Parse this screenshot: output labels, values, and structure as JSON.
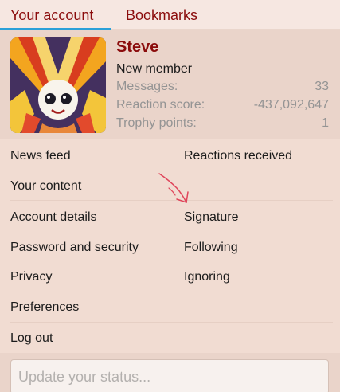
{
  "tabs": {
    "account": "Your account",
    "bookmarks": "Bookmarks",
    "active": "account",
    "accent_color": "#2aa0d8"
  },
  "profile": {
    "username": "Steve",
    "user_title": "New member",
    "avatar_icon": "avatar-cartoon-character",
    "stats": [
      {
        "label": "Messages:",
        "value": "33"
      },
      {
        "label": "Reaction score:",
        "value": "-437,092,647"
      },
      {
        "label": "Trophy points:",
        "value": "1"
      }
    ]
  },
  "menu": {
    "left": [
      "News feed",
      "Your content",
      "Account details",
      "Password and security",
      "Privacy",
      "Preferences",
      "Log out"
    ],
    "right": [
      "Reactions received",
      "Signature",
      "Following",
      "Ignoring"
    ]
  },
  "status": {
    "placeholder": "Update your status..."
  },
  "colors": {
    "brand": "#8b0c0c",
    "panel": "#f1dcd2",
    "annotation": "#e0445a"
  }
}
